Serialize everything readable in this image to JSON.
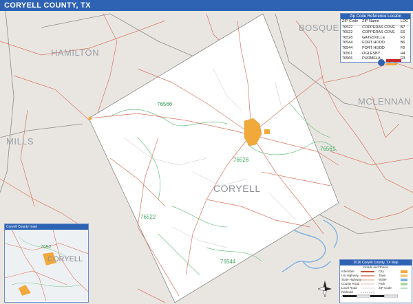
{
  "title": "CORYELL COUNTY, TX",
  "counties": {
    "hamilton": "HAMILTON",
    "bosque": "BOSQUE",
    "mclennan": "MCLENNAN",
    "mills": "MILLS",
    "coryell": "CORYELL"
  },
  "zip_labels": {
    "z76566": "76566",
    "z76528": "76528",
    "z76561": "76561",
    "z76522": "76522",
    "z76544": "76544"
  },
  "zip_table": {
    "title": "Zip Code Reference Locator",
    "headers": [
      "ZIP Code",
      "ZIP Name",
      "LOC"
    ],
    "rows": [
      [
        "76522",
        "COPPERAS COVE",
        "B7"
      ],
      [
        "76522",
        "COPPERAS COVE",
        "E6"
      ],
      [
        "76528",
        "GATESVILLE",
        "F3"
      ],
      [
        "76544",
        "FORT HOOD",
        "B6"
      ],
      [
        "76544",
        "FORT HOOD",
        "F8"
      ],
      [
        "76561",
        "OGLESBY",
        "H4"
      ],
      [
        "76566",
        "PURMELA",
        "D3"
      ]
    ]
  },
  "inset": {
    "title": "Coryell County Inset",
    "label": "CORYELL",
    "zip": "7652"
  },
  "legend": {
    "title": "2016 Coryell County, TX Map",
    "subtitle": "Roads and Towns",
    "rows_left": [
      "Interstate",
      "US Highway",
      "State Highway",
      "County Road",
      "Local Road",
      "Railroad",
      "Airport"
    ],
    "rows_right": [
      "City",
      "Town",
      "Water",
      "Park",
      "ZIP Code"
    ]
  },
  "colors": {
    "title_bar": "#2e63b4",
    "background_outside": "#e9e6e1",
    "county_fill": "#ffffff",
    "roads": "#d9735b",
    "zip_boundaries": "#6cc281",
    "city": "#f2a93b",
    "water": "#7fb2e5",
    "county_boundary": "#777777"
  }
}
